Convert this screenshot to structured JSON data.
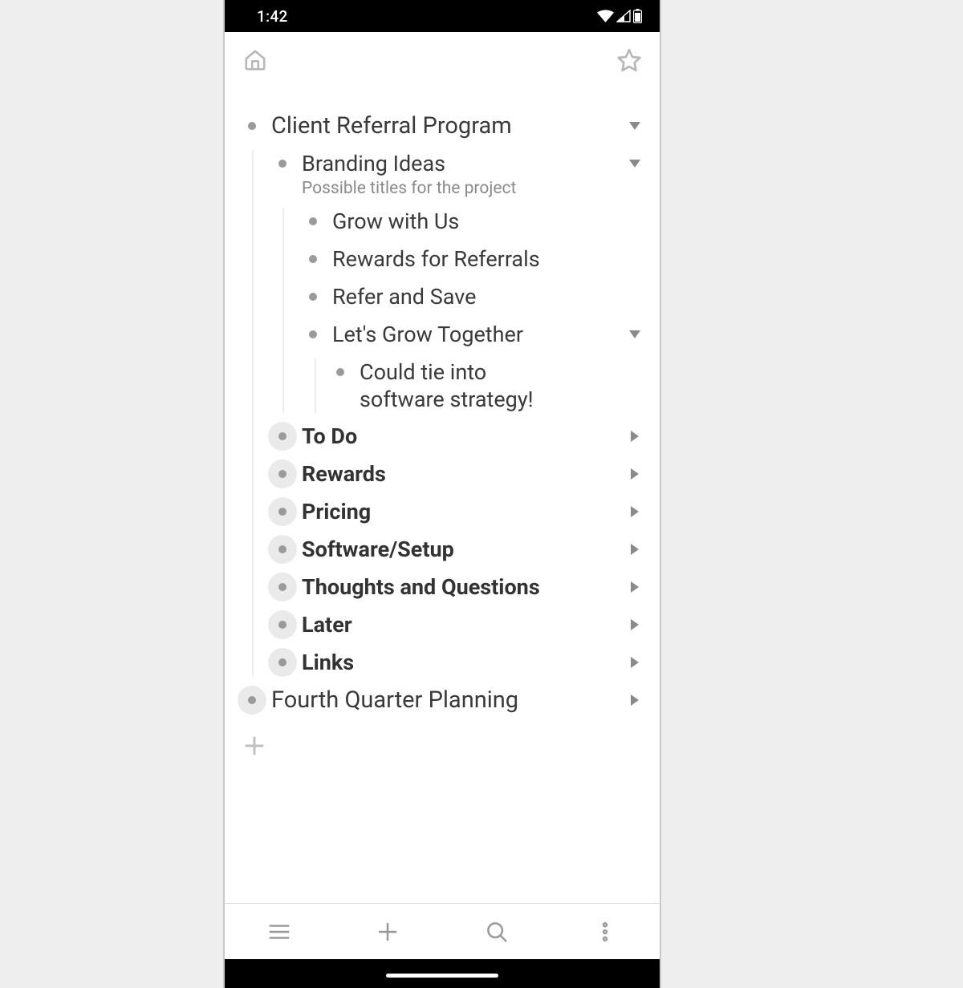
{
  "status": {
    "time": "1:42"
  },
  "outline": {
    "items": [
      {
        "label": "Client Referral Program",
        "expanded": true,
        "children": [
          {
            "label": "Branding Ideas",
            "note": "Possible titles for the project",
            "expanded": true,
            "children": [
              {
                "label": "Grow with Us"
              },
              {
                "label": "Rewards for Referrals"
              },
              {
                "label": "Refer and Save"
              },
              {
                "label": "Let's Grow Together",
                "expanded": true,
                "children": [
                  {
                    "label": "Could tie into software strategy!"
                  }
                ]
              }
            ]
          },
          {
            "label": "To Do",
            "collapsed": true,
            "bold": true
          },
          {
            "label": "Rewards",
            "collapsed": true,
            "bold": true
          },
          {
            "label": "Pricing",
            "collapsed": true,
            "bold": true
          },
          {
            "label": "Software/Setup",
            "collapsed": true,
            "bold": true
          },
          {
            "label": "Thoughts and Questions",
            "collapsed": true,
            "bold": true
          },
          {
            "label": "Later",
            "collapsed": true,
            "bold": true
          },
          {
            "label": "Links",
            "collapsed": true,
            "bold": true
          }
        ]
      },
      {
        "label": "Fourth Quarter Planning",
        "collapsed": true
      }
    ]
  }
}
